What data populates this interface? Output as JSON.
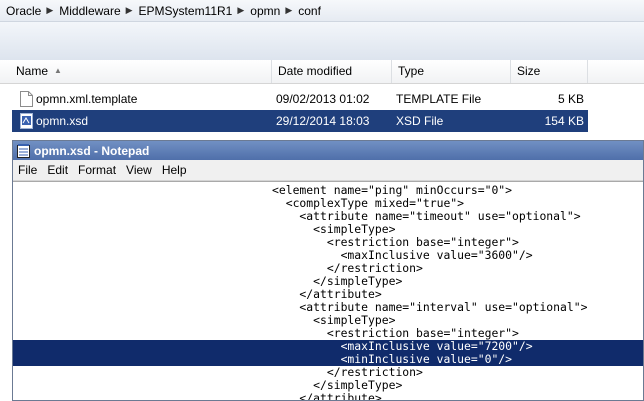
{
  "breadcrumb": [
    "Oracle",
    "Middleware",
    "EPMSystem11R1",
    "opmn",
    "conf"
  ],
  "columns": {
    "name": "Name",
    "date": "Date modified",
    "type": "Type",
    "size": "Size"
  },
  "files": [
    {
      "name": "opmn.xml.template",
      "date": "09/02/2013 01:02",
      "type": "TEMPLATE File",
      "size": "5 KB",
      "icon": "document-icon",
      "selected": false
    },
    {
      "name": "opmn.xsd",
      "date": "29/12/2014 18:03",
      "type": "XSD File",
      "size": "154 KB",
      "icon": "xsd-file-icon",
      "selected": true
    }
  ],
  "notepad": {
    "title": "opmn.xsd - Notepad",
    "menu": [
      "File",
      "Edit",
      "Format",
      "View",
      "Help"
    ],
    "lines": [
      "<element name=\"ping\" minOccurs=\"0\">",
      "  <complexType mixed=\"true\">",
      "    <attribute name=\"timeout\" use=\"optional\">",
      "      <simpleType>",
      "        <restriction base=\"integer\">",
      "          <maxInclusive value=\"3600\"/>",
      "        </restriction>",
      "      </simpleType>",
      "    </attribute>",
      "    <attribute name=\"interval\" use=\"optional\">",
      "      <simpleType>",
      "        <restriction base=\"integer\">",
      "          <maxInclusive value=\"7200\"/>",
      "          <minInclusive value=\"0\"/>",
      "        </restriction>",
      "      </simpleType>",
      "    </attribute>"
    ],
    "selected_lines": [
      12,
      13
    ]
  },
  "colors": {
    "selection": "#1f3f7c",
    "titlebar": "#5b7bb5"
  }
}
